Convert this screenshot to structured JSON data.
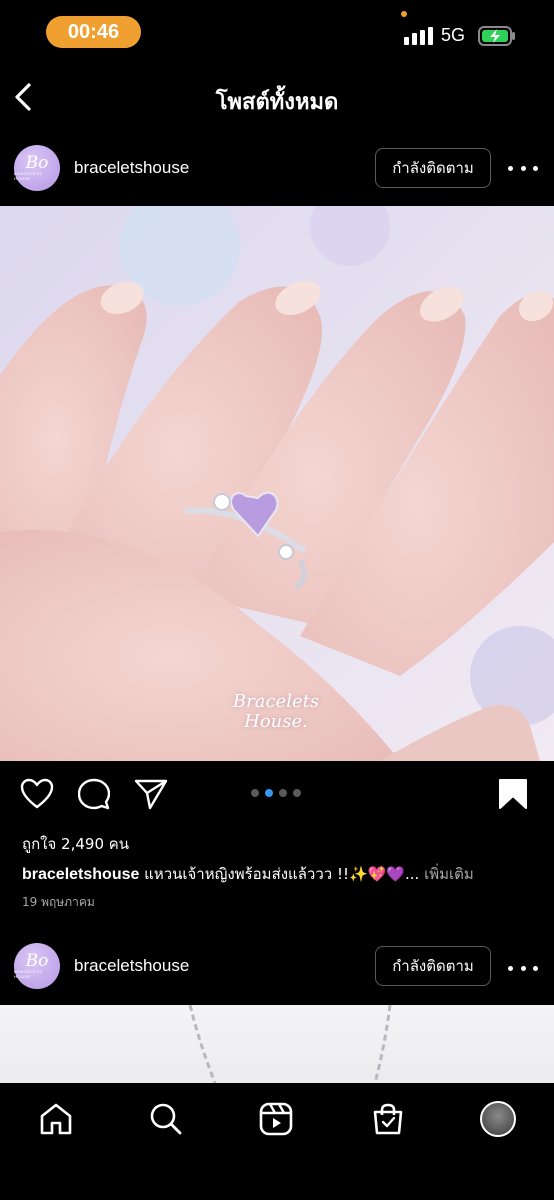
{
  "status_bar": {
    "time": "00:46",
    "network": "5G"
  },
  "header": {
    "title": "โพสต์ทั้งหมด"
  },
  "posts": [
    {
      "username": "braceletshouse",
      "follow_label": "กำลังติดตาม",
      "avatar_text": "Bo",
      "avatar_small_text": "BRACELETS HOUSE",
      "watermark_line1": "Bracelets",
      "watermark_line2": "House.",
      "carousel": {
        "count": 4,
        "active_index": 1
      },
      "likes": "ถูกใจ 2,490 คน",
      "caption_user": "braceletshouse",
      "caption_text": " แหวนเจ้าหญิงพร้อมส่งแล้ววว !!✨💖💜... ",
      "caption_more": "เพิ่มเติม",
      "date": "19 พฤษภาคม",
      "saved": true
    },
    {
      "username": "braceletshouse",
      "follow_label": "กำลังติดตาม",
      "avatar_text": "Bo",
      "avatar_small_text": "BRACELETS HOUSE"
    }
  ],
  "icons": {
    "back": "chevron-left-icon",
    "like": "heart-icon",
    "comment": "comment-icon",
    "share": "send-icon",
    "save": "bookmark-icon",
    "nav": [
      "home-icon",
      "search-icon",
      "reels-icon",
      "shop-icon",
      "profile-avatar"
    ]
  },
  "colors": {
    "accent_blue": "#3897f0",
    "time_pill": "#f0a030",
    "battery_green": "#30d158",
    "background": "#000000"
  }
}
